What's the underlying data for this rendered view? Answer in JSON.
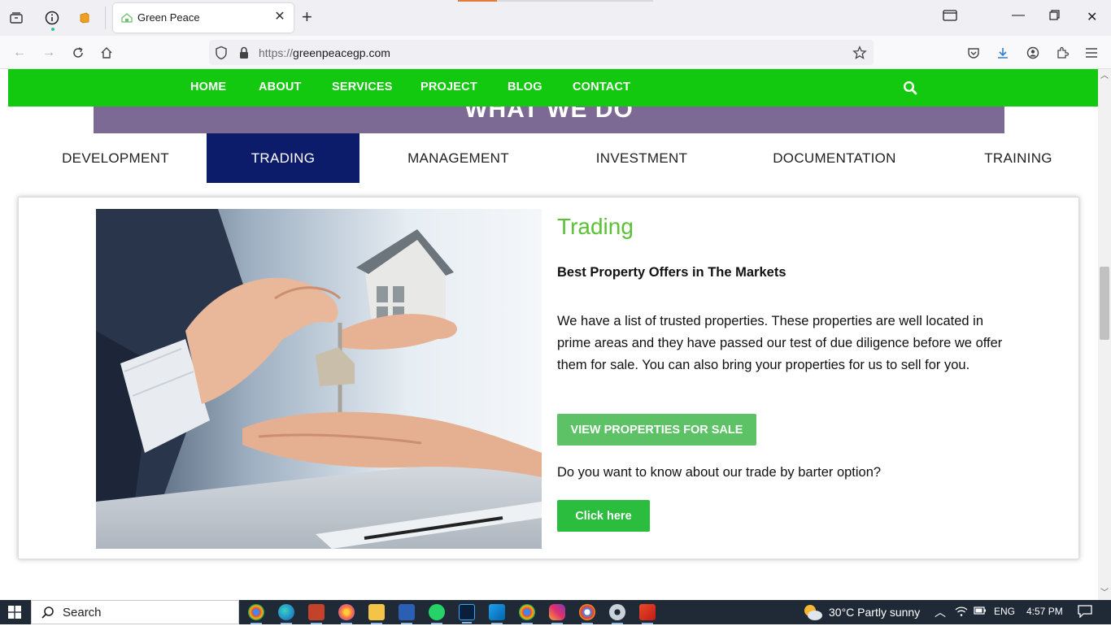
{
  "browser": {
    "tab_title": "Green Peace",
    "url_protocol": "https://",
    "url_host": "greenpeacegp.com"
  },
  "site_nav": {
    "items": [
      "HOME",
      "ABOUT",
      "SERVICES",
      "PROJECT",
      "BLOG",
      "CONTACT"
    ]
  },
  "section": {
    "heading": "WHAT WE DO"
  },
  "tabs": [
    "DEVELOPMENT",
    "TRADING",
    "MANAGEMENT",
    "INVESTMENT",
    "DOCUMENTATION",
    "TRAINING"
  ],
  "active_tab": "TRADING",
  "content": {
    "title": "Trading",
    "subtitle": "Best Property Offers in The Markets",
    "paragraph": "We have a list of trusted properties. These properties are well located in prime areas and they have passed our test of due diligence before we offer them for sale. You can also bring your properties for us to sell for you.",
    "primary_button": "VIEW PROPERTIES FOR SALE",
    "question": "Do you want to know about our trade by barter option?",
    "secondary_button": "Click here"
  },
  "taskbar": {
    "search_label": "Search",
    "weather": "30°C  Partly sunny",
    "language": "ENG",
    "time": "4:57 PM"
  },
  "colors": {
    "site_green": "#13c90f",
    "section_purple": "#7d6a94",
    "active_tab_navy": "#0d1b6b",
    "title_green": "#5bc236",
    "button_green": "#5cc265"
  }
}
